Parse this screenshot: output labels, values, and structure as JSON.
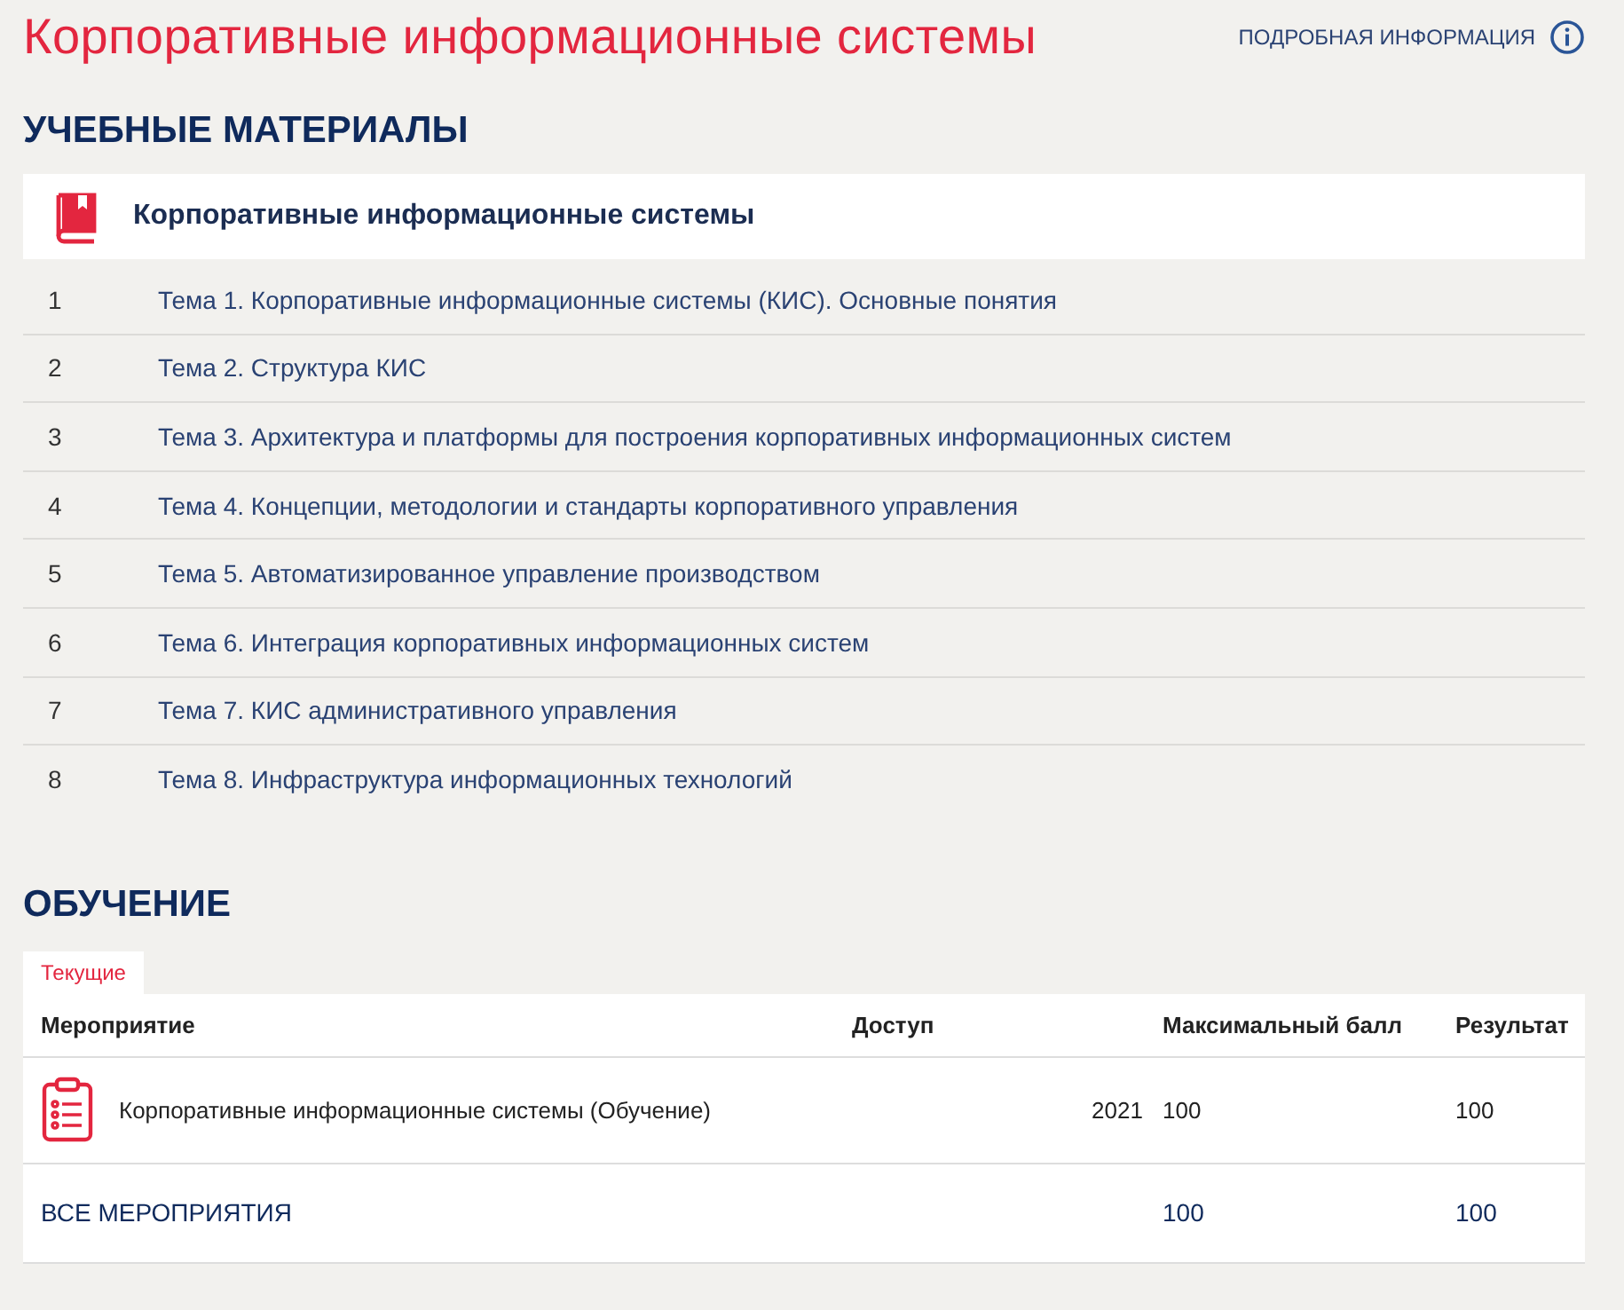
{
  "page_title": "Корпоративные информационные системы",
  "info_link": "ПОДРОБНАЯ ИНФОРМАЦИЯ",
  "materials": {
    "heading": "УЧЕБНЫЕ МАТЕРИАЛЫ",
    "course_title": "Корпоративные информационные системы",
    "topics": [
      {
        "number": "1",
        "title": "Тема 1. Корпоративные информационные системы (КИС). Основные понятия"
      },
      {
        "number": "2",
        "title": "Тема 2. Структура КИС"
      },
      {
        "number": "3",
        "title": "Тема 3. Архитектура и платформы для построения корпоративных информационных систем"
      },
      {
        "number": "4",
        "title": "Тема 4. Концепции, методологии и стандарты корпоративного управления"
      },
      {
        "number": "5",
        "title": "Тема 5. Автоматизированное управление производством"
      },
      {
        "number": "6",
        "title": "Тема 6. Интеграция корпоративных информационных систем"
      },
      {
        "number": "7",
        "title": "Тема 7. КИС административного управления"
      },
      {
        "number": "8",
        "title": "Тема 8. Инфраструктура информационных технологий"
      }
    ]
  },
  "training": {
    "heading": "ОБУЧЕНИЕ",
    "tabs": [
      {
        "label": "Текущие",
        "selected": true
      }
    ],
    "columns": [
      "Мероприятие",
      "Доступ",
      "Максимальный балл",
      "Результат"
    ],
    "rows": [
      {
        "event": "Корпоративные информационные системы (Обучение)",
        "access": "2021",
        "max_score": "100",
        "result": "100"
      }
    ],
    "total": {
      "label": "ВСЕ МЕРОПРИЯТИЯ",
      "max_score": "100",
      "result": "100"
    }
  }
}
